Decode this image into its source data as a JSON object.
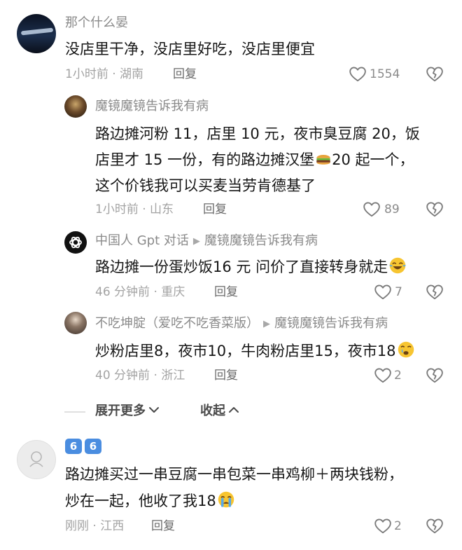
{
  "comments": [
    {
      "name": "那个什么晏",
      "lines": [
        "没店里干净，没店里好吃，没店里便宜"
      ],
      "time": "1小时前 · 湖南",
      "reply": "回复",
      "likes": "1554"
    },
    {
      "name": "魔镜魔镜告诉我有病",
      "lines": [
        "路边摊河粉 11，店里 10 元，夜市臭豆腐 20，饭",
        "店里才 15 一份，有的路边摊汉堡",
        "20 起一个，",
        "这个价钱我可以买麦当劳肯德基了"
      ],
      "time": "1小时前 · 山东",
      "reply": "回复",
      "likes": "89"
    },
    {
      "name": "中国人 Gpt 对话",
      "reply_to": "魔镜魔镜告诉我有病",
      "lines": [
        "路边摊一份蛋炒饭16 元  问价了直接转身就走"
      ],
      "time": "46 分钟前 · 重庆",
      "reply": "回复",
      "likes": "7"
    },
    {
      "name": "不吃坤腚（爱吃不吃香菜版）",
      "reply_to": "魔镜魔镜告诉我有病",
      "lines": [
        "炒粉店里8，夜市10，牛肉粉店里15，夜市18"
      ],
      "time": "40 分钟前 · 浙江",
      "reply": "回复",
      "likes": "2"
    },
    {
      "badges": [
        "6",
        "6"
      ],
      "lines": [
        "路边摊买过一串豆腐一串包菜一串鸡柳＋两块钱粉，",
        "炒在一起，他收了我18"
      ],
      "time": "刚刚 · 江西",
      "reply": "回复",
      "likes": "2"
    }
  ],
  "expand_more": "展开更多",
  "collapse": "收起",
  "icons": {
    "like": "heart-outline-icon",
    "dislike": "broken-heart-icon",
    "reply_arrow": "triangle-right-icon",
    "chevron_down": "chevron-down-icon",
    "chevron_up": "chevron-up-icon"
  }
}
